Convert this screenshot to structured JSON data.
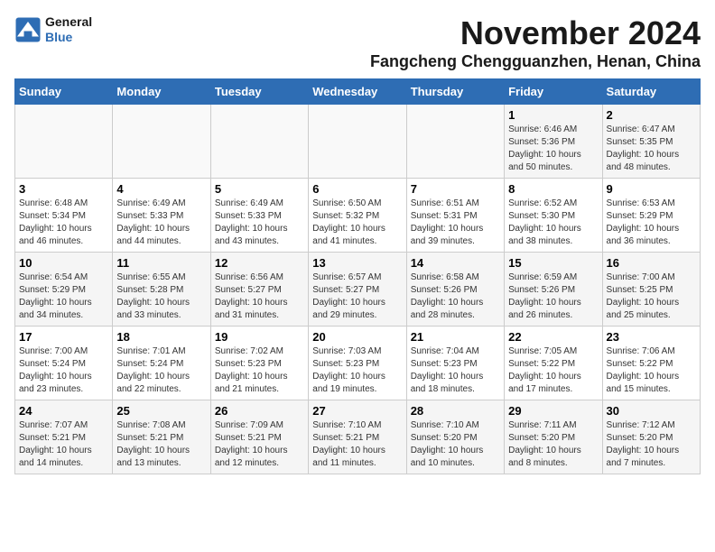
{
  "header": {
    "logo_general": "General",
    "logo_blue": "Blue",
    "month_title": "November 2024",
    "location": "Fangcheng Chengguanzhen, Henan, China"
  },
  "weekdays": [
    "Sunday",
    "Monday",
    "Tuesday",
    "Wednesday",
    "Thursday",
    "Friday",
    "Saturday"
  ],
  "weeks": [
    [
      {
        "day": "",
        "info": ""
      },
      {
        "day": "",
        "info": ""
      },
      {
        "day": "",
        "info": ""
      },
      {
        "day": "",
        "info": ""
      },
      {
        "day": "",
        "info": ""
      },
      {
        "day": "1",
        "info": "Sunrise: 6:46 AM\nSunset: 5:36 PM\nDaylight: 10 hours\nand 50 minutes."
      },
      {
        "day": "2",
        "info": "Sunrise: 6:47 AM\nSunset: 5:35 PM\nDaylight: 10 hours\nand 48 minutes."
      }
    ],
    [
      {
        "day": "3",
        "info": "Sunrise: 6:48 AM\nSunset: 5:34 PM\nDaylight: 10 hours\nand 46 minutes."
      },
      {
        "day": "4",
        "info": "Sunrise: 6:49 AM\nSunset: 5:33 PM\nDaylight: 10 hours\nand 44 minutes."
      },
      {
        "day": "5",
        "info": "Sunrise: 6:49 AM\nSunset: 5:33 PM\nDaylight: 10 hours\nand 43 minutes."
      },
      {
        "day": "6",
        "info": "Sunrise: 6:50 AM\nSunset: 5:32 PM\nDaylight: 10 hours\nand 41 minutes."
      },
      {
        "day": "7",
        "info": "Sunrise: 6:51 AM\nSunset: 5:31 PM\nDaylight: 10 hours\nand 39 minutes."
      },
      {
        "day": "8",
        "info": "Sunrise: 6:52 AM\nSunset: 5:30 PM\nDaylight: 10 hours\nand 38 minutes."
      },
      {
        "day": "9",
        "info": "Sunrise: 6:53 AM\nSunset: 5:29 PM\nDaylight: 10 hours\nand 36 minutes."
      }
    ],
    [
      {
        "day": "10",
        "info": "Sunrise: 6:54 AM\nSunset: 5:29 PM\nDaylight: 10 hours\nand 34 minutes."
      },
      {
        "day": "11",
        "info": "Sunrise: 6:55 AM\nSunset: 5:28 PM\nDaylight: 10 hours\nand 33 minutes."
      },
      {
        "day": "12",
        "info": "Sunrise: 6:56 AM\nSunset: 5:27 PM\nDaylight: 10 hours\nand 31 minutes."
      },
      {
        "day": "13",
        "info": "Sunrise: 6:57 AM\nSunset: 5:27 PM\nDaylight: 10 hours\nand 29 minutes."
      },
      {
        "day": "14",
        "info": "Sunrise: 6:58 AM\nSunset: 5:26 PM\nDaylight: 10 hours\nand 28 minutes."
      },
      {
        "day": "15",
        "info": "Sunrise: 6:59 AM\nSunset: 5:26 PM\nDaylight: 10 hours\nand 26 minutes."
      },
      {
        "day": "16",
        "info": "Sunrise: 7:00 AM\nSunset: 5:25 PM\nDaylight: 10 hours\nand 25 minutes."
      }
    ],
    [
      {
        "day": "17",
        "info": "Sunrise: 7:00 AM\nSunset: 5:24 PM\nDaylight: 10 hours\nand 23 minutes."
      },
      {
        "day": "18",
        "info": "Sunrise: 7:01 AM\nSunset: 5:24 PM\nDaylight: 10 hours\nand 22 minutes."
      },
      {
        "day": "19",
        "info": "Sunrise: 7:02 AM\nSunset: 5:23 PM\nDaylight: 10 hours\nand 21 minutes."
      },
      {
        "day": "20",
        "info": "Sunrise: 7:03 AM\nSunset: 5:23 PM\nDaylight: 10 hours\nand 19 minutes."
      },
      {
        "day": "21",
        "info": "Sunrise: 7:04 AM\nSunset: 5:23 PM\nDaylight: 10 hours\nand 18 minutes."
      },
      {
        "day": "22",
        "info": "Sunrise: 7:05 AM\nSunset: 5:22 PM\nDaylight: 10 hours\nand 17 minutes."
      },
      {
        "day": "23",
        "info": "Sunrise: 7:06 AM\nSunset: 5:22 PM\nDaylight: 10 hours\nand 15 minutes."
      }
    ],
    [
      {
        "day": "24",
        "info": "Sunrise: 7:07 AM\nSunset: 5:21 PM\nDaylight: 10 hours\nand 14 minutes."
      },
      {
        "day": "25",
        "info": "Sunrise: 7:08 AM\nSunset: 5:21 PM\nDaylight: 10 hours\nand 13 minutes."
      },
      {
        "day": "26",
        "info": "Sunrise: 7:09 AM\nSunset: 5:21 PM\nDaylight: 10 hours\nand 12 minutes."
      },
      {
        "day": "27",
        "info": "Sunrise: 7:10 AM\nSunset: 5:21 PM\nDaylight: 10 hours\nand 11 minutes."
      },
      {
        "day": "28",
        "info": "Sunrise: 7:10 AM\nSunset: 5:20 PM\nDaylight: 10 hours\nand 10 minutes."
      },
      {
        "day": "29",
        "info": "Sunrise: 7:11 AM\nSunset: 5:20 PM\nDaylight: 10 hours\nand 8 minutes."
      },
      {
        "day": "30",
        "info": "Sunrise: 7:12 AM\nSunset: 5:20 PM\nDaylight: 10 hours\nand 7 minutes."
      }
    ]
  ]
}
